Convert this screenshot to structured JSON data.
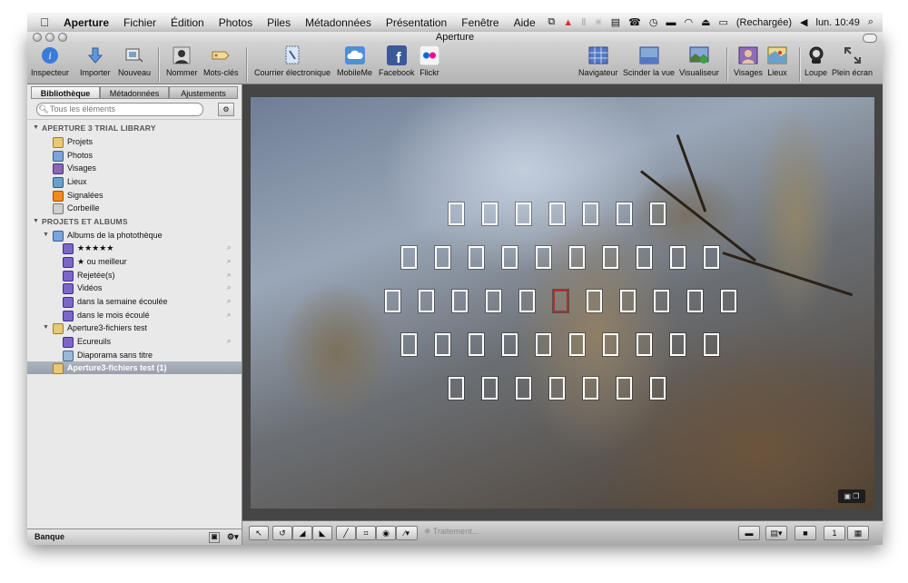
{
  "menubar": {
    "apple_icon": "apple-logo",
    "menus": [
      "Aperture",
      "Fichier",
      "Édition",
      "Photos",
      "Piles",
      "Métadonnées",
      "Présentation",
      "Fenêtre",
      "Aide"
    ],
    "battery_text": "(Rechargée)",
    "clock": "lun. 10:49"
  },
  "window": {
    "title": "Aperture"
  },
  "toolbar": {
    "items": [
      {
        "label": "Inspecteur",
        "icon": "info-icon"
      },
      {
        "label": "Importer",
        "icon": "import-arrow-icon"
      },
      {
        "label": "Nouveau",
        "icon": "new-album-icon"
      },
      {
        "label": "Nommer",
        "icon": "person-icon"
      },
      {
        "label": "Mots-clés",
        "icon": "tag-icon"
      },
      {
        "label": "Courrier électronique",
        "icon": "mail-stamp-icon"
      },
      {
        "label": "MobileMe",
        "icon": "cloud-icon"
      },
      {
        "label": "Facebook",
        "icon": "facebook-icon"
      },
      {
        "label": "Flickr",
        "icon": "flickr-icon"
      },
      {
        "label": "Navigateur",
        "icon": "grid-browser-icon"
      },
      {
        "label": "Scinder la vue",
        "icon": "split-view-icon"
      },
      {
        "label": "Visualiseur",
        "icon": "viewer-icon"
      },
      {
        "label": "Visages",
        "icon": "faces-icon"
      },
      {
        "label": "Lieux",
        "icon": "places-map-icon"
      },
      {
        "label": "Loupe",
        "icon": "loupe-icon"
      },
      {
        "label": "Plein écran",
        "icon": "fullscreen-icon"
      }
    ]
  },
  "sidebar": {
    "tabs": [
      "Bibliothèque",
      "Métadonnées",
      "Ajustements"
    ],
    "search_placeholder": "Tous les éléments",
    "library_header": "APERTURE 3 TRIAL LIBRARY",
    "library_items": [
      "Projets",
      "Photos",
      "Visages",
      "Lieux",
      "Signalées",
      "Corbeille"
    ],
    "projects_header": "PROJETS ET ALBUMS",
    "phototheque": "Albums de la photothèque",
    "smart_albums": [
      "★★★★★",
      "★ ou meilleur",
      "Rejetée(s)",
      "Vidéos",
      "dans la semaine écoulée",
      "dans le mois écoulé"
    ],
    "project1": "Aperture3-fichiers test",
    "project1_items": [
      "Ecureuils",
      "Diaporama sans titre"
    ],
    "selected_project": "Aperture3-fichiers test (1)",
    "bottom_label": "Banque"
  },
  "viewer": {
    "processing_label": "Traitement..."
  }
}
